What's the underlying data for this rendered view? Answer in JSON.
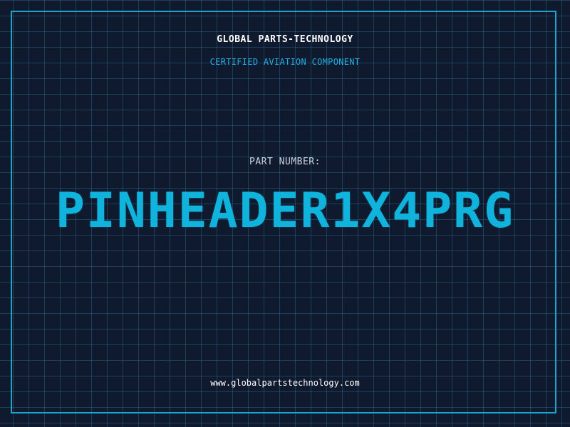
{
  "header": {
    "company": "GLOBAL PARTS-TECHNOLOGY",
    "tagline": "CERTIFIED AVIATION COMPONENT"
  },
  "part": {
    "label": "PART NUMBER:",
    "number": "PINHEADER1X4PRG"
  },
  "footer": {
    "website": "www.globalpartstechnology.com"
  },
  "colors": {
    "background": "#101a2e",
    "grid": "#2d6a8a",
    "accent": "#0fb3dc",
    "frame": "#1ba6cf",
    "text": "#ffffff"
  }
}
